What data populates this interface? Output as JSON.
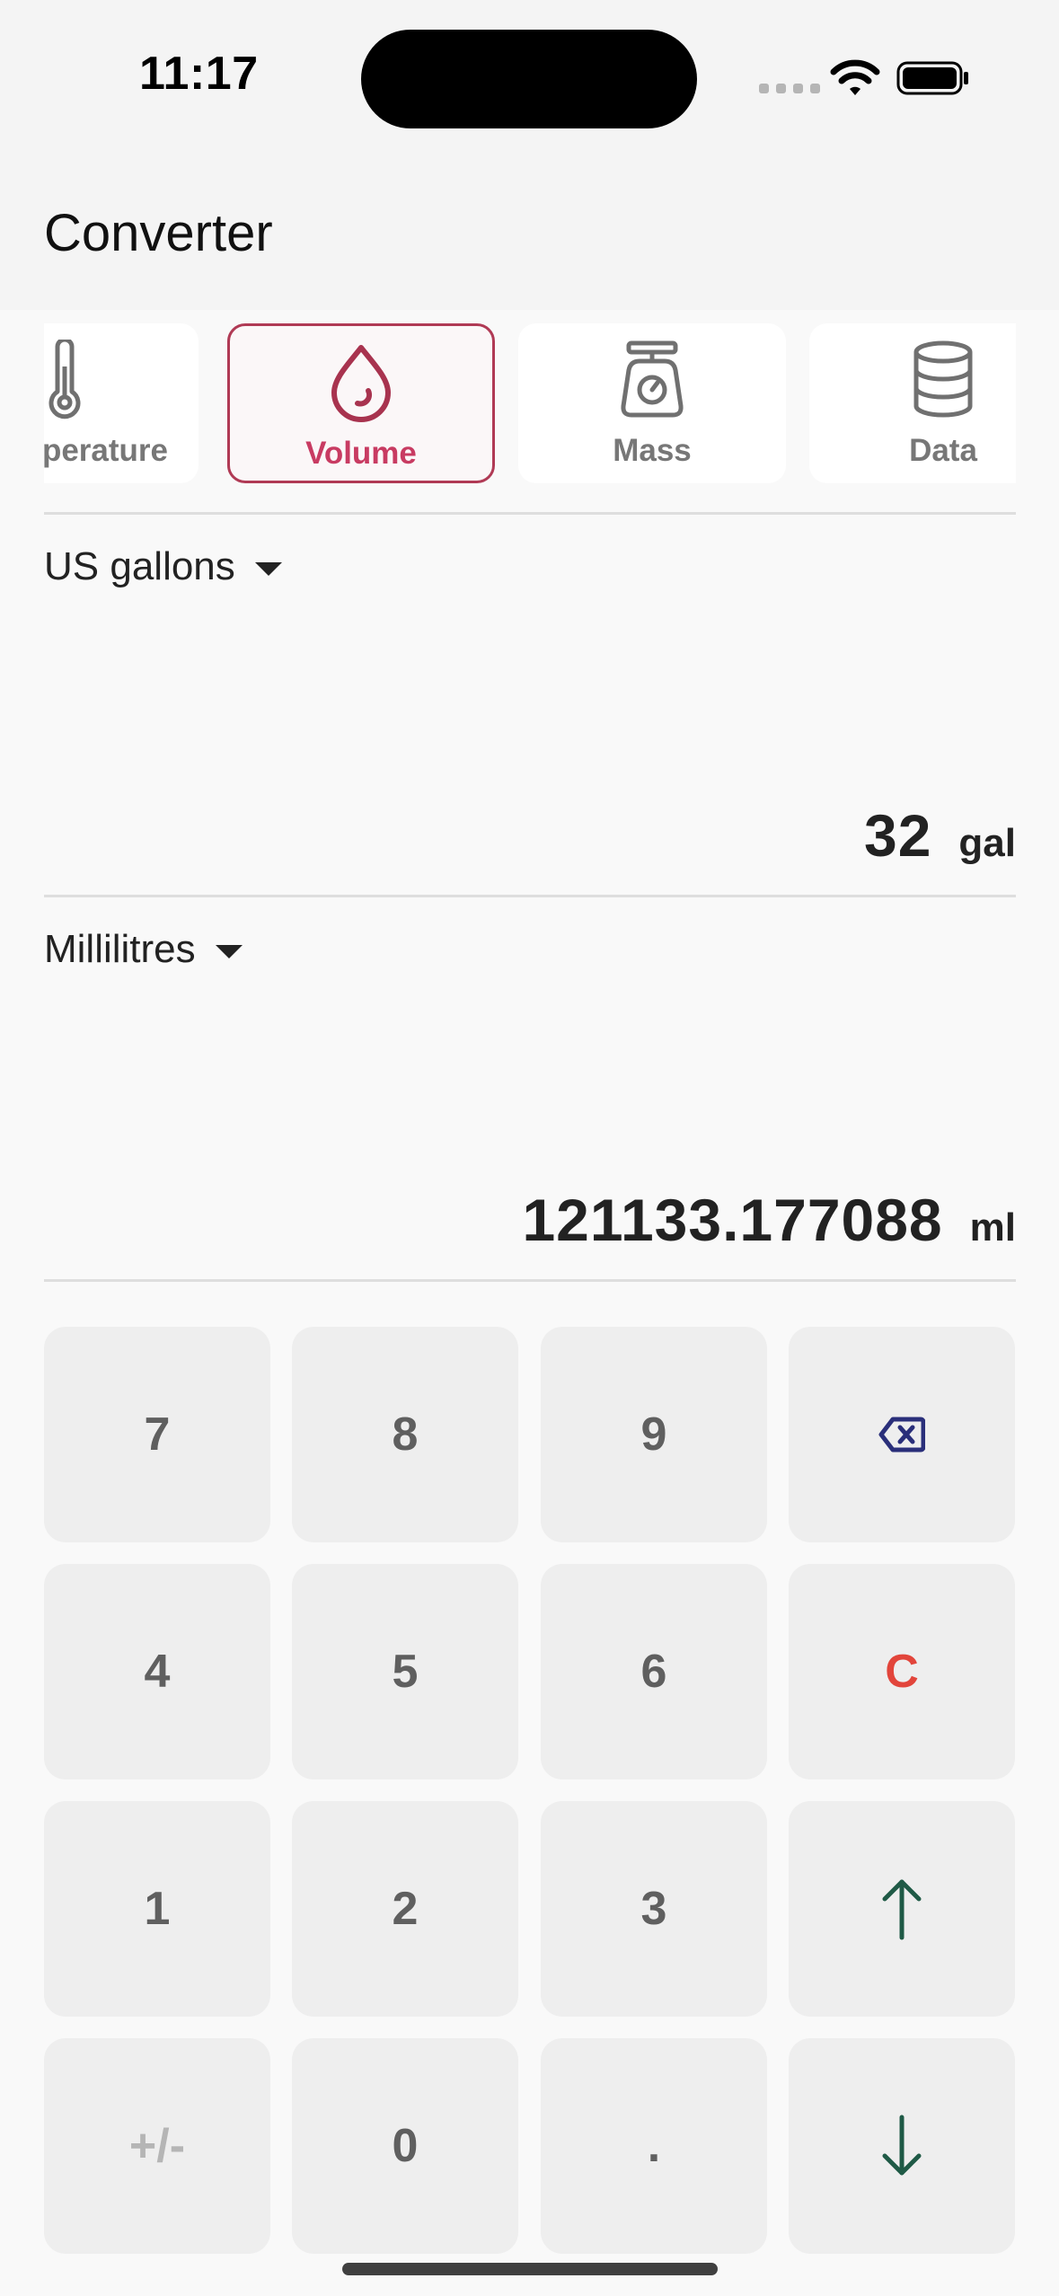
{
  "status": {
    "time": "11:17"
  },
  "app": {
    "title": "Converter"
  },
  "categories": [
    {
      "label": "perature",
      "icon": "thermometer-icon",
      "active": false
    },
    {
      "label": "Volume",
      "icon": "drop-icon",
      "active": true
    },
    {
      "label": "Mass",
      "icon": "scale-icon",
      "active": false
    },
    {
      "label": "Data",
      "icon": "database-icon",
      "active": false
    }
  ],
  "from": {
    "unit": "US gallons",
    "value": "32",
    "symbol": "gal"
  },
  "to": {
    "unit": "Millilitres",
    "value": "121133.177088",
    "symbol": "ml"
  },
  "keypad": {
    "rows": [
      [
        "7",
        "8",
        "9",
        "backspace-icon"
      ],
      [
        "4",
        "5",
        "6",
        "C"
      ],
      [
        "1",
        "2",
        "3",
        "arrow-up-icon"
      ],
      [
        "+/-",
        "0",
        ".",
        "arrow-down-icon"
      ]
    ]
  },
  "colors": {
    "accent": "#c83b62",
    "active_border": "#b03a55",
    "clear": "#e2453b",
    "arrow": "#1f5a46",
    "backspace": "#2a2f7a"
  }
}
